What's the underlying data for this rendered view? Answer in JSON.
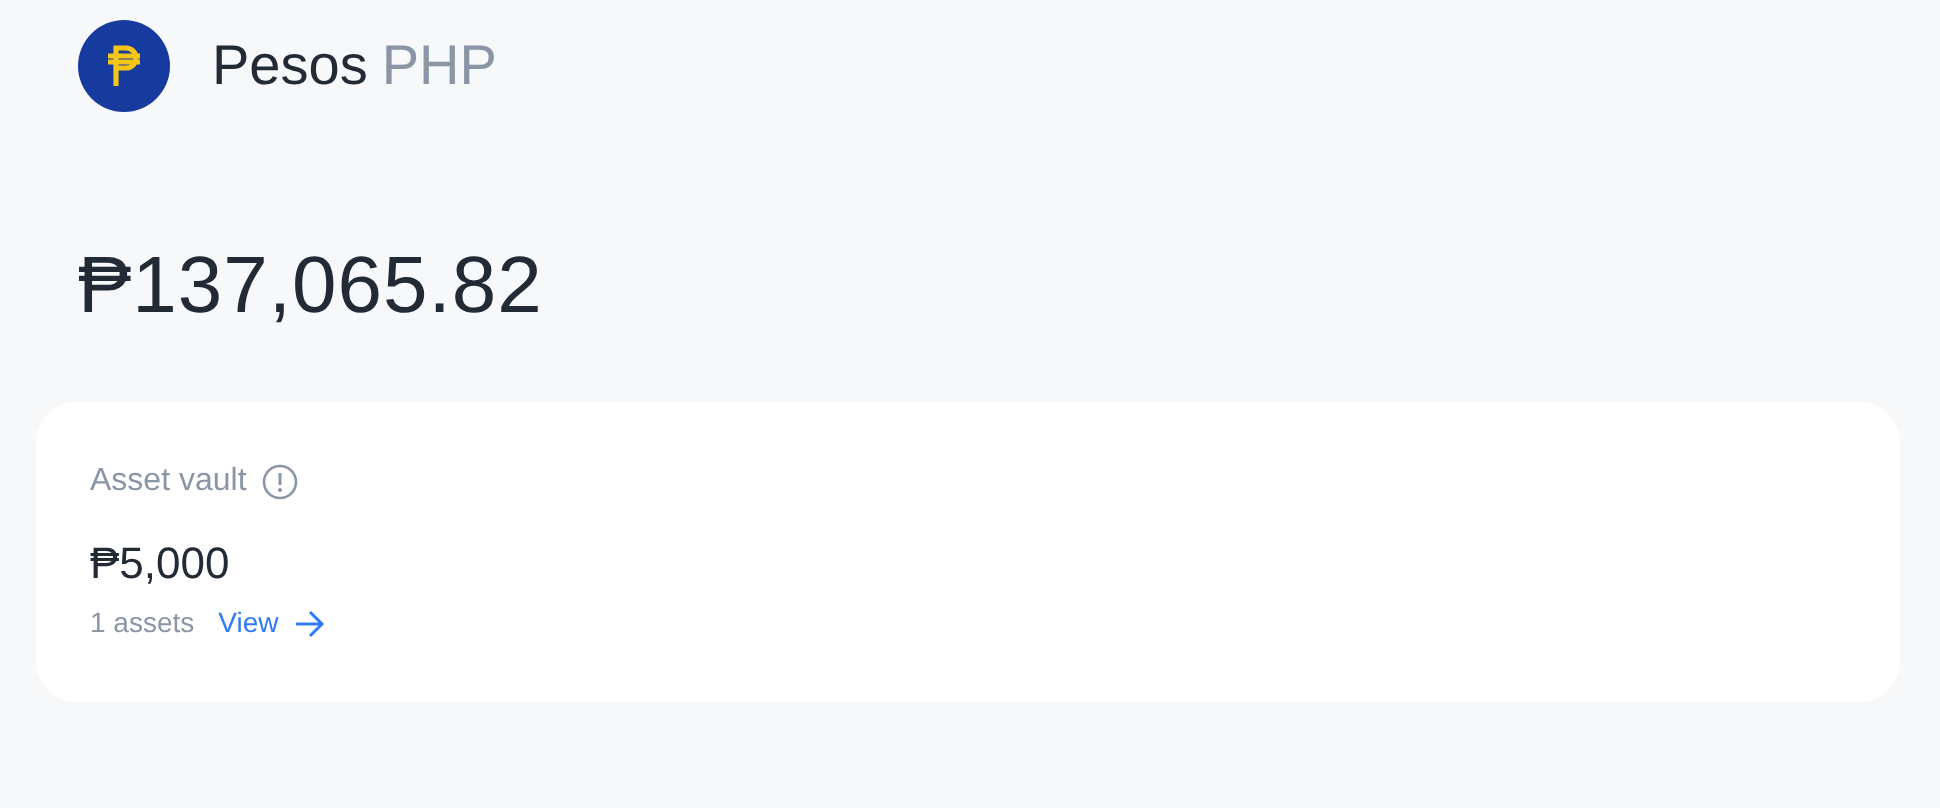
{
  "header": {
    "name": "Pesos",
    "code": "PHP"
  },
  "balance": "₱137,065.82",
  "asset_vault": {
    "title": "Asset vault",
    "amount": "₱5,000",
    "count": "1 assets",
    "link": "View"
  }
}
